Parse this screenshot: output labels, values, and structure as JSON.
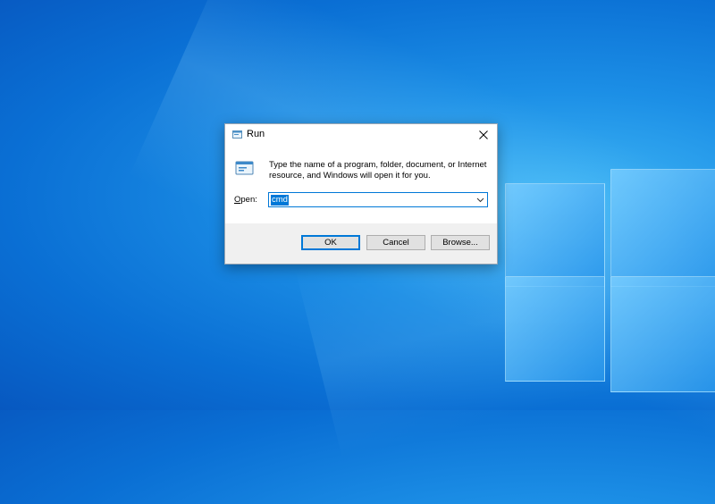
{
  "dialog": {
    "title": "Run",
    "description": "Type the name of a program, folder, document, or Internet resource, and Windows will open it for you.",
    "open_label_accel": "O",
    "open_label_rest": "pen:",
    "input_value": "cmd",
    "buttons": {
      "ok": "OK",
      "cancel": "Cancel",
      "browse": "Browse..."
    }
  },
  "icons": {
    "title": "run-icon",
    "content": "run-icon",
    "close": "close-icon",
    "dropdown": "chevron-down-icon"
  },
  "colors": {
    "accent": "#0078d7",
    "desktop": "#1c8fe6",
    "footer": "#f0f0f0"
  }
}
